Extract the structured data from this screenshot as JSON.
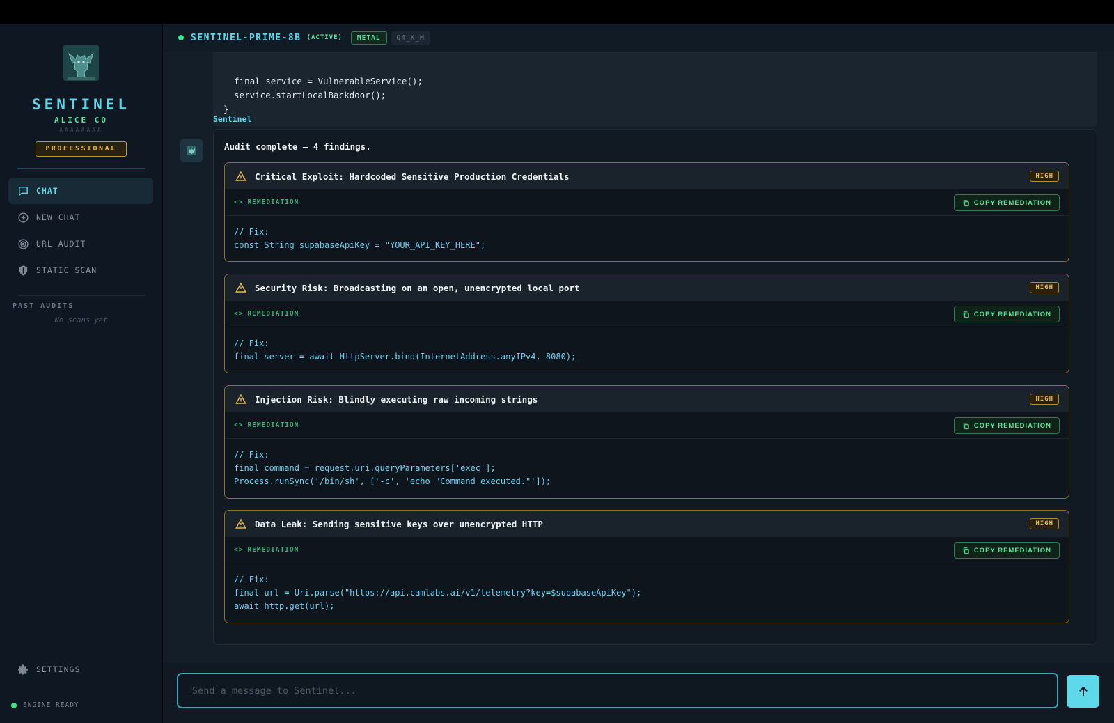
{
  "brand": {
    "title": "SENTINEL",
    "org": "ALICE CO",
    "account_id": "AAAAAAAA",
    "tier": "PROFESSIONAL",
    "logo_icon": "gargoyle-logo-icon"
  },
  "sidebar": {
    "nav": [
      {
        "label": "CHAT",
        "icon": "chat-bubble-icon",
        "active": true
      },
      {
        "label": "NEW CHAT",
        "icon": "plus-circle-icon",
        "active": false
      },
      {
        "label": "URL AUDIT",
        "icon": "target-icon",
        "active": false
      },
      {
        "label": "STATIC SCAN",
        "icon": "shield-icon",
        "active": false
      }
    ],
    "past_audits_title": "PAST AUDITS",
    "past_audits_empty": "No scans yet",
    "settings_label": "SETTINGS",
    "engine_status": "ENGINE READY"
  },
  "model": {
    "name": "SENTINEL-PRIME-8B",
    "status": "(ACTIVE)",
    "backend": "METAL",
    "quant": "Q4_K_M"
  },
  "previous_code": {
    "lines": [
      "  final service = VulnerableService();",
      "  service.startLocalBackdoor();",
      "}"
    ]
  },
  "message": {
    "sender": "Sentinel",
    "summary": "Audit complete — 4 findings.",
    "remediation_label": "REMEDIATION",
    "copy_label": "COPY REMEDIATION",
    "findings": [
      {
        "title": "Critical Exploit: Hardcoded Sensitive Production Credentials",
        "severity": "HIGH",
        "code": "// Fix:\nconst String supabaseApiKey = \"YOUR_API_KEY_HERE\";"
      },
      {
        "title": "Security Risk: Broadcasting on an open, unencrypted local port",
        "severity": "HIGH",
        "code": "// Fix:\nfinal server = await HttpServer.bind(InternetAddress.anyIPv4, 8080);"
      },
      {
        "title": "Injection Risk: Blindly executing raw incoming strings",
        "severity": "HIGH",
        "code": "// Fix:\nfinal command = request.uri.queryParameters['exec'];\nProcess.runSync('/bin/sh', ['-c', 'echo \"Command executed.\"']);"
      },
      {
        "title": "Data Leak: Sending sensitive keys over unencrypted HTTP",
        "severity": "HIGH",
        "code": "// Fix:\nfinal url = Uri.parse(\"https://api.camlabs.ai/v1/telemetry?key=$supabaseApiKey\");\nawait http.get(url);"
      }
    ]
  },
  "composer": {
    "placeholder": "Send a message to Sentinel...",
    "send_icon": "arrow-up-icon"
  },
  "colors": {
    "accent": "#5fd8ea",
    "success": "#57e39a",
    "warning": "#e6b943"
  }
}
